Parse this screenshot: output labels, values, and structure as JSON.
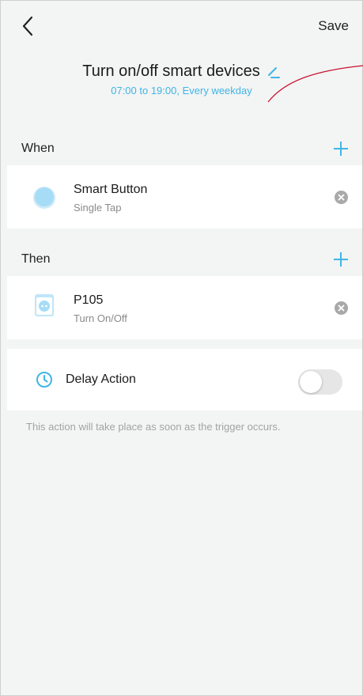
{
  "header": {
    "back_icon": "chevron-left-icon",
    "save_label": "Save"
  },
  "title_block": {
    "title": "Turn on/off smart devices",
    "subtitle": "07:00 to 19:00, Every weekday",
    "edit_icon": "pencil-icon"
  },
  "when_section": {
    "label": "When",
    "add_icon": "plus-icon",
    "item": {
      "title": "Smart Button",
      "subtitle": "Single Tap",
      "icon": "smart-button-icon"
    }
  },
  "then_section": {
    "label": "Then",
    "add_icon": "plus-icon",
    "item": {
      "title": "P105",
      "subtitle": "Turn On/Off",
      "icon": "smart-plug-icon"
    }
  },
  "delay": {
    "label": "Delay Action",
    "icon": "clock-icon",
    "enabled": false
  },
  "note": "This action will take place as soon as the trigger occurs.",
  "colors": {
    "accent": "#3fb6e6",
    "background": "#f3f4f4",
    "card": "#ffffff",
    "annotation": "#c8102e"
  }
}
